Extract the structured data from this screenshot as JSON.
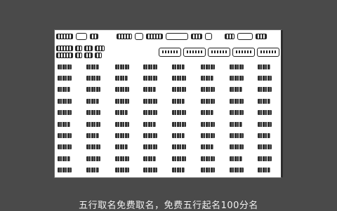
{
  "caption": "五行取名免费取名，免费五行起名100分名",
  "colors": {
    "backdrop": "#4a4a4a",
    "paper": "#ffffff",
    "ink": "#1e1e1e",
    "caption_text": "#f2f2f2"
  }
}
